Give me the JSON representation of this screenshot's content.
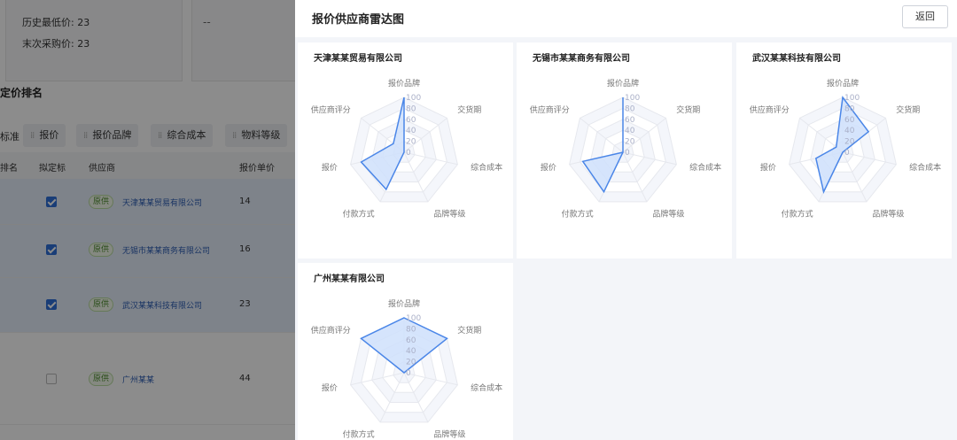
{
  "background": {
    "stats": {
      "hist_low_label": "历史最低价:",
      "hist_low_value": "23",
      "last_purchase_label": "末次采购价:",
      "last_purchase_value": "23",
      "placeholder": "--"
    },
    "section_title": "定价排名",
    "toolbar": {
      "label": "标准",
      "chips": [
        "报价",
        "报价品牌",
        "综合成本",
        "物料等级"
      ]
    },
    "table": {
      "headers": [
        "排名",
        "拟定标",
        "供应商",
        "报价单价"
      ],
      "rows": [
        {
          "checked": true,
          "tag": "原供",
          "supplier": "天津某某贸易有限公司",
          "price": "14"
        },
        {
          "checked": true,
          "tag": "原供",
          "supplier": "无锡市某某商务有限公司",
          "price": "16"
        },
        {
          "checked": true,
          "tag": "原供",
          "supplier": "武汉某某科技有限公司",
          "price": "23"
        },
        {
          "checked": false,
          "tag": "原供",
          "supplier": "广州某某",
          "price": "44"
        }
      ]
    }
  },
  "drawer": {
    "title": "报价供应商雷达图",
    "back_label": "返回",
    "axes": [
      "报价品牌",
      "交货期",
      "综合成本",
      "品牌等级",
      "付款方式",
      "报价",
      "供应商评分"
    ],
    "ticks": [
      "100",
      "80",
      "60",
      "40",
      "20",
      "0"
    ],
    "accent_color": "#4a86e8",
    "fill_color": "#cfe0fb",
    "suppliers": [
      {
        "name": "天津某某贸易有限公司",
        "values": [
          100,
          0,
          0,
          0,
          75,
          80,
          25
        ]
      },
      {
        "name": "无锡市某某商务有限公司",
        "values": [
          100,
          0,
          0,
          0,
          80,
          75,
          0
        ]
      },
      {
        "name": "武汉某某科技有限公司",
        "values": [
          100,
          60,
          0,
          0,
          80,
          50,
          15
        ]
      },
      {
        "name": "广州某某有限公司",
        "values": [
          100,
          100,
          0,
          0,
          0,
          0,
          100
        ]
      }
    ]
  }
}
